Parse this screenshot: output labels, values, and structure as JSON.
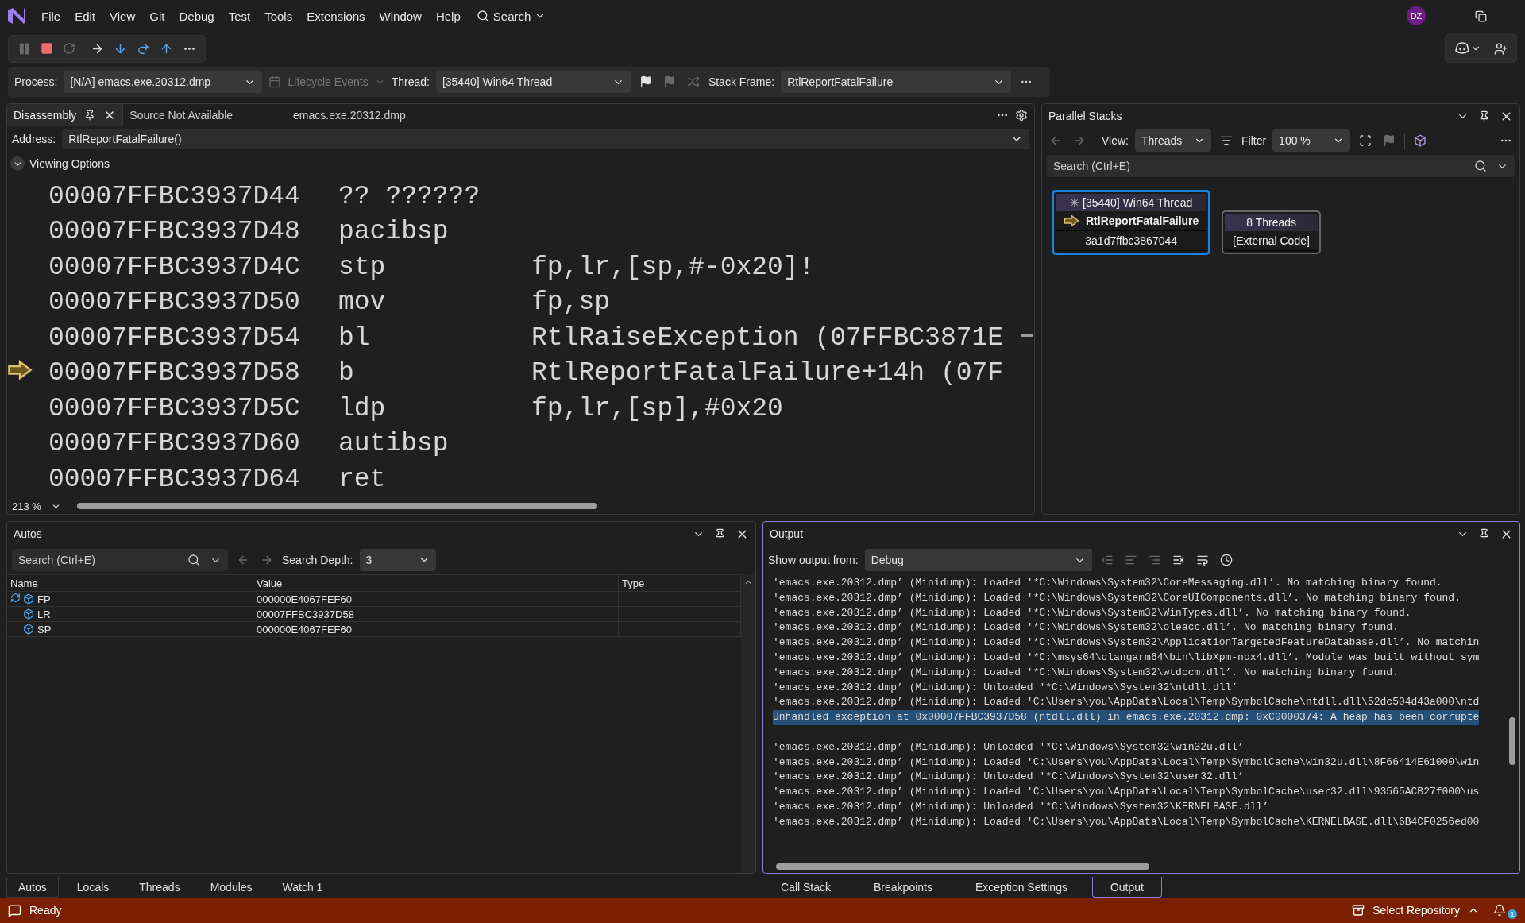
{
  "menu": [
    "File",
    "Edit",
    "View",
    "Git",
    "Debug",
    "Test",
    "Tools",
    "Extensions",
    "Window",
    "Help"
  ],
  "search_label": "Search",
  "avatar": "DZ",
  "debug_bar": {
    "process_label": "Process:",
    "process": "[N/A] emacs.exe.20312.dmp",
    "lifecycle": "Lifecycle Events",
    "thread_label": "Thread:",
    "thread": "[35440] Win64 Thread",
    "stack_frame_label": "Stack Frame:",
    "stack_frame": "RtlReportFatalFailure"
  },
  "disassembly": {
    "tabs": [
      {
        "label": "Disassembly",
        "selected": true
      },
      {
        "label": "Source Not Available",
        "selected": false
      },
      {
        "label": "emacs.exe.20312.dmp",
        "selected": false
      }
    ],
    "address_label": "Address:",
    "address": "RtlReportFatalFailure()",
    "viewing_options": "Viewing Options",
    "zoom": "213 %",
    "rows": [
      {
        "address": "00007FFBC3937D44",
        "mnemonic": "?? ??????",
        "current": false
      },
      {
        "address": "00007FFBC3937D48",
        "mnemonic": "pacibsp",
        "current": false
      },
      {
        "address": "00007FFBC3937D4C",
        "mnemonic": "stp",
        "operands": "fp,lr,[sp,#-0x20]!",
        "current": false
      },
      {
        "address": "00007FFBC3937D50",
        "mnemonic": "mov",
        "operands": "fp,sp",
        "current": false
      },
      {
        "address": "00007FFBC3937D54",
        "mnemonic": "bl",
        "operands": "RtlRaiseException (07FFBC3871E",
        "current": false
      },
      {
        "address": "00007FFBC3937D58",
        "mnemonic": "b",
        "operands": "RtlReportFatalFailure+14h (07F",
        "current": true
      },
      {
        "address": "00007FFBC3937D5C",
        "mnemonic": "ldp",
        "operands": "fp,lr,[sp],#0x20",
        "current": false
      },
      {
        "address": "00007FFBC3937D60",
        "mnemonic": "autibsp",
        "current": false
      },
      {
        "address": "00007FFBC3937D64",
        "mnemonic": "ret",
        "current": false
      }
    ]
  },
  "parallel_stacks": {
    "title": "Parallel Stacks",
    "view_label": "View:",
    "view": "Threads",
    "filter": "Filter",
    "zoom": "100 %",
    "search_placeholder": "Search (Ctrl+E)",
    "nodes": [
      {
        "marker": "✳",
        "header": "[35440] Win64 Thread",
        "frames": [
          {
            "text": "RtlReportFatalFailure",
            "current": true
          },
          {
            "text": "3a1d7ffbc3867044",
            "current": false
          }
        ],
        "selected": true
      },
      {
        "header": "8 Threads",
        "frames": [
          {
            "text": "[External Code]",
            "current": false
          }
        ],
        "selected": false
      }
    ]
  },
  "autos": {
    "title": "Autos",
    "search_placeholder": "Search (Ctrl+E)",
    "depth_label": "Search Depth:",
    "depth": "3",
    "columns": [
      "Name",
      "Value",
      "Type"
    ],
    "rows": [
      {
        "name": "FP",
        "value": "000000E4067FEF60",
        "refreshable": true
      },
      {
        "name": "LR",
        "value": "00007FFBC3937D58",
        "refreshable": false
      },
      {
        "name": "SP",
        "value": "000000E4067FEF60",
        "refreshable": false
      }
    ]
  },
  "output": {
    "title": "Output",
    "source_label": "Show output from:",
    "source": "Debug",
    "lines": [
      {
        "kind": "text",
        "text": "'emacs.exe.20312.dmp’ (Minidump): Loaded '*C:\\Windows\\System32\\CoreMessaging.dll’. No matching binary found.",
        "selected": false
      },
      {
        "kind": "text",
        "text": "'emacs.exe.20312.dmp’ (Minidump): Loaded '*C:\\Windows\\System32\\CoreUIComponents.dll’. No matching binary found.",
        "selected": false
      },
      {
        "kind": "text",
        "text": "'emacs.exe.20312.dmp’ (Minidump): Loaded '*C:\\Windows\\System32\\WinTypes.dll’. No matching binary found.",
        "selected": false
      },
      {
        "kind": "text",
        "text": "'emacs.exe.20312.dmp’ (Minidump): Loaded '*C:\\Windows\\System32\\oleacc.dll’. No matching binary found.",
        "selected": false
      },
      {
        "kind": "text",
        "text": "'emacs.exe.20312.dmp’ (Minidump): Loaded '*C:\\Windows\\System32\\ApplicationTargetedFeatureDatabase.dll’. No matchin",
        "selected": false
      },
      {
        "kind": "text",
        "text": "'emacs.exe.20312.dmp’ (Minidump): Loaded '*C:\\msys64\\clangarm64\\bin\\libXpm-nox4.dll’. Module was built without sym",
        "selected": false
      },
      {
        "kind": "text",
        "text": "'emacs.exe.20312.dmp’ (Minidump): Loaded '*C:\\Windows\\System32\\wtdccm.dll’. No matching binary found.",
        "selected": false
      },
      {
        "kind": "text",
        "text": "'emacs.exe.20312.dmp’ (Minidump): Unloaded '*C:\\Windows\\System32\\ntdll.dll’",
        "selected": false
      },
      {
        "kind": "text",
        "text": "'emacs.exe.20312.dmp’ (Minidump): Loaded 'C:\\Users\\you\\AppData\\Local\\Temp\\SymbolCache\\ntdll.dll\\52dc504d43a000\\ntd",
        "selected": false
      },
      {
        "kind": "text",
        "text": "Unhandled exception at 0x00007FFBC3937D58 (ntdll.dll) in emacs.exe.20312.dmp: 0xC0000374: A heap has been corrupte",
        "selected": true
      },
      {
        "kind": "blank"
      },
      {
        "kind": "text",
        "text": "'emacs.exe.20312.dmp’ (Minidump): Unloaded '*C:\\Windows\\System32\\win32u.dll’",
        "selected": false
      },
      {
        "kind": "text",
        "text": "'emacs.exe.20312.dmp’ (Minidump): Loaded 'C:\\Users\\you\\AppData\\Local\\Temp\\SymbolCache\\win32u.dll\\8F66414E61000\\win",
        "selected": false
      },
      {
        "kind": "text",
        "text": "'emacs.exe.20312.dmp’ (Minidump): Unloaded '*C:\\Windows\\System32\\user32.dll’",
        "selected": false
      },
      {
        "kind": "text",
        "text": "'emacs.exe.20312.dmp’ (Minidump): Loaded 'C:\\Users\\you\\AppData\\Local\\Temp\\SymbolCache\\user32.dll\\93565ACB27f000\\us",
        "selected": false
      },
      {
        "kind": "text",
        "text": "'emacs.exe.20312.dmp’ (Minidump): Unloaded '*C:\\Windows\\System32\\KERNELBASE.dll’",
        "selected": false
      },
      {
        "kind": "text",
        "text": "'emacs.exe.20312.dmp’ (Minidump): Loaded 'C:\\Users\\you\\AppData\\Local\\Temp\\SymbolCache\\KERNELBASE.dll\\6B4CF0256ed00",
        "selected": false
      }
    ]
  },
  "left_tabs": [
    {
      "label": "Autos",
      "selected": true
    },
    {
      "label": "Locals",
      "selected": false
    },
    {
      "label": "Threads",
      "selected": false
    },
    {
      "label": "Modules",
      "selected": false
    },
    {
      "label": "Watch 1",
      "selected": false
    }
  ],
  "right_tabs": [
    {
      "label": "Call Stack",
      "selected": false
    },
    {
      "label": "Breakpoints",
      "selected": false
    },
    {
      "label": "Exception Settings",
      "selected": false
    },
    {
      "label": "Output",
      "selected": true
    }
  ],
  "status_bar": {
    "text": "Ready",
    "repository": "Select Repository",
    "notifications": "1"
  }
}
